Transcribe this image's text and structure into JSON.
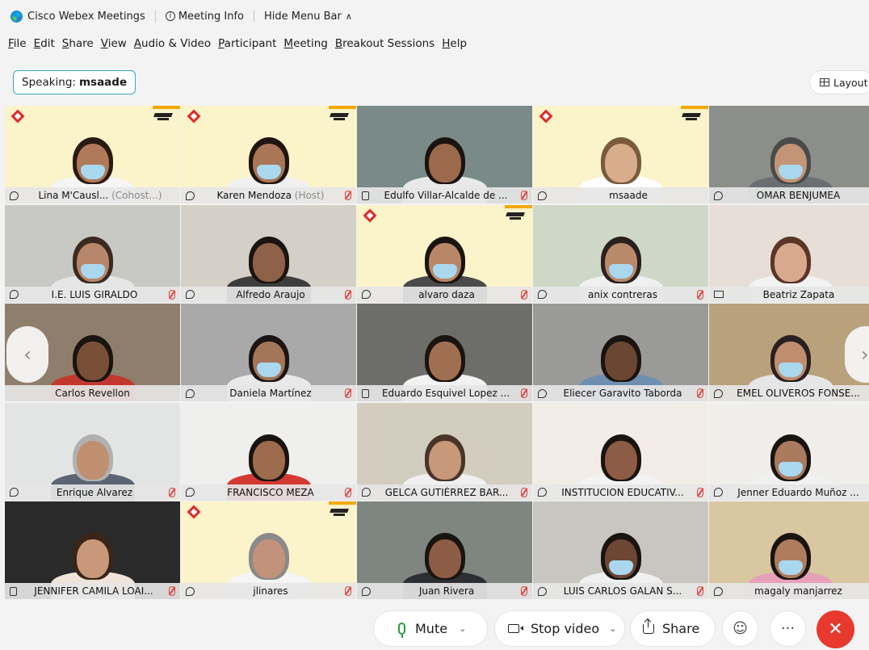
{
  "titlebar": {
    "app_title": "Cisco Webex Meetings",
    "meeting_info": "Meeting Info",
    "hide_menu": "Hide Menu Bar"
  },
  "menu": [
    "File",
    "Edit",
    "Share",
    "View",
    "Audio & Video",
    "Participant",
    "Meeting",
    "Breakout Sessions",
    "Help"
  ],
  "speaking": {
    "label": "Speaking:",
    "name": "msaade"
  },
  "layout_label": "Layout",
  "participants": [
    {
      "name": "Lina M'Causl...",
      "role": "(Cohost...)",
      "icon": "audio-icon",
      "muted": false
    },
    {
      "name": "Karen Mendoza",
      "role": "(Host)",
      "icon": "audio-icon",
      "muted": true
    },
    {
      "name": "Edulfo Villar-Alcalde de ...",
      "role": "",
      "icon": "device-icon",
      "muted": true
    },
    {
      "name": "msaade",
      "role": "",
      "icon": "audio-icon",
      "muted": false
    },
    {
      "name": "OMAR BENJUMEA",
      "role": "",
      "icon": "audio-icon",
      "muted": false
    },
    {
      "name": "I.E. LUIS GIRALDO",
      "role": "",
      "icon": "audio-icon",
      "muted": true
    },
    {
      "name": "Alfredo Araujo",
      "role": "",
      "icon": "audio-icon",
      "muted": true
    },
    {
      "name": "alvaro daza",
      "role": "",
      "icon": "audio-icon",
      "muted": true
    },
    {
      "name": "anix contreras",
      "role": "",
      "icon": "audio-icon",
      "muted": true
    },
    {
      "name": "Beatriz Zapata",
      "role": "",
      "icon": "screen-icon",
      "muted": false
    },
    {
      "name": "Carlos Revellon",
      "role": "",
      "icon": "",
      "muted": false
    },
    {
      "name": "Daniela Martínez",
      "role": "",
      "icon": "audio-icon",
      "muted": true
    },
    {
      "name": "Eduardo Esquivel Lopez ...",
      "role": "",
      "icon": "device-icon",
      "muted": true
    },
    {
      "name": "Eliecer Garavito Taborda",
      "role": "",
      "icon": "audio-icon",
      "muted": true
    },
    {
      "name": "EMEL OLIVEROS FONSE...",
      "role": "",
      "icon": "audio-icon",
      "muted": false
    },
    {
      "name": "Enrique Alvarez",
      "role": "",
      "icon": "audio-icon",
      "muted": true
    },
    {
      "name": "FRANCISCO MEZA",
      "role": "",
      "icon": "audio-icon",
      "muted": true
    },
    {
      "name": "GELCA GUTIÉRREZ BAR...",
      "role": "",
      "icon": "audio-icon",
      "muted": true
    },
    {
      "name": "INSTITUCION EDUCATIV...",
      "role": "",
      "icon": "audio-icon",
      "muted": true
    },
    {
      "name": "Jenner Eduardo Muñoz ...",
      "role": "",
      "icon": "audio-icon",
      "muted": false
    },
    {
      "name": "JENNIFER CAMILA LOAI...",
      "role": "",
      "icon": "device-icon",
      "muted": true
    },
    {
      "name": "jlinares",
      "role": "",
      "icon": "audio-icon",
      "muted": true
    },
    {
      "name": "Juan Rivera",
      "role": "",
      "icon": "audio-icon",
      "muted": true
    },
    {
      "name": "LUIS CARLOS GALAN S...",
      "role": "",
      "icon": "audio-icon",
      "muted": true
    },
    {
      "name": "magaly manjarrez",
      "role": "",
      "icon": "audio-icon",
      "muted": false
    }
  ],
  "controls": {
    "mute": "Mute",
    "stop_video": "Stop video",
    "share": "Share",
    "more": "···",
    "end": "✕"
  },
  "colors": {
    "accent_selected": "#17b6de",
    "end_call": "#e8392f",
    "mic_green": "#2a9d3f",
    "muted_red": "#e0403a",
    "banner_yellow": "#fbf3c9"
  }
}
